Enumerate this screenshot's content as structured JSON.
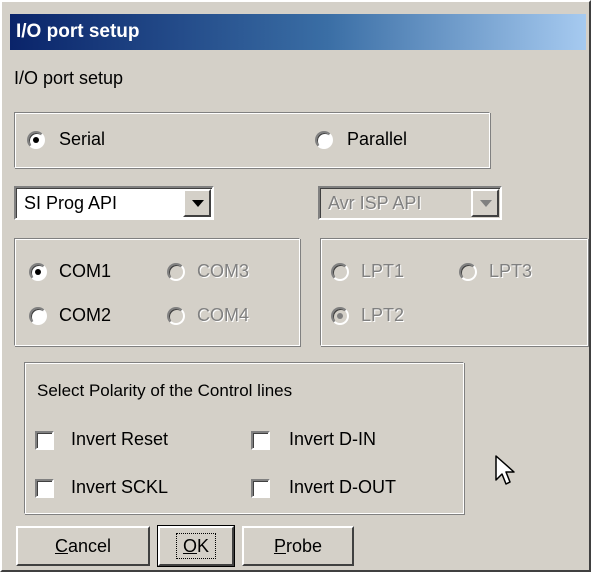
{
  "window": {
    "title": "I/O port setup"
  },
  "subtitle": "I/O port setup",
  "interface": {
    "serial_label": "Serial",
    "serial_selected": true,
    "parallel_label": "Parallel",
    "parallel_selected": false
  },
  "serial_api": {
    "value": "SI Prog API"
  },
  "parallel_api": {
    "value": "Avr ISP API",
    "disabled": true
  },
  "com_ports": [
    {
      "label": "COM1",
      "selected": true,
      "enabled": true
    },
    {
      "label": "COM3",
      "selected": false,
      "enabled": false
    },
    {
      "label": "COM2",
      "selected": false,
      "enabled": true
    },
    {
      "label": "COM4",
      "selected": false,
      "enabled": false
    }
  ],
  "lpt_ports": [
    {
      "label": "LPT1",
      "selected": false,
      "enabled": false
    },
    {
      "label": "LPT3",
      "selected": false,
      "enabled": false
    },
    {
      "label": "LPT2",
      "selected": true,
      "enabled": false
    }
  ],
  "polarity": {
    "heading": "Select Polarity of the Control lines",
    "invert_reset": "Invert Reset",
    "invert_din": "Invert D-IN",
    "invert_sckl": "Invert SCKL",
    "invert_dout": "Invert D-OUT"
  },
  "buttons": {
    "cancel_mnemonic": "C",
    "cancel_rest": "ancel",
    "ok_mnemonic": "O",
    "ok_rest": "K",
    "probe_mnemonic": "P",
    "probe_rest": "robe"
  },
  "colors": {
    "title_start": "#0a246a",
    "title_end": "#a6caf0",
    "face": "#d4d0c8",
    "disabled_text": "#808080"
  }
}
